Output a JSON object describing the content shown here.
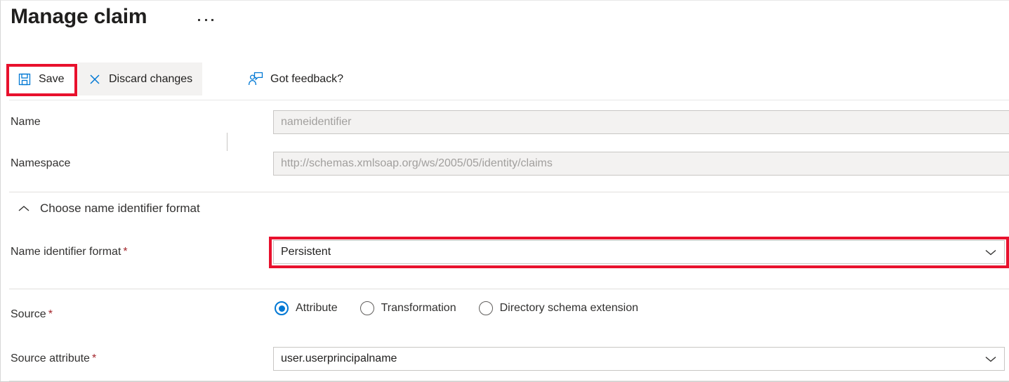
{
  "header": {
    "title": "Manage claim",
    "more_menu": "…"
  },
  "toolbar": {
    "save_label": "Save",
    "save_icon": "save-floppy-icon",
    "discard_label": "Discard changes",
    "discard_icon": "close-x-icon",
    "feedback_label": "Got feedback?",
    "feedback_icon": "person-feedback-icon"
  },
  "form": {
    "name": {
      "label": "Name",
      "value": "nameidentifier",
      "disabled": true
    },
    "namespace": {
      "label": "Namespace",
      "value": "http://schemas.xmlsoap.org/ws/2005/05/identity/claims",
      "disabled": true
    },
    "section": {
      "title": "Choose name identifier format",
      "expanded": true,
      "caret_icon": "chevron-up-icon"
    },
    "name_identifier_format": {
      "label": "Name identifier format",
      "required_marker": "*",
      "value": "Persistent",
      "chevron_icon": "chevron-down-icon",
      "highlighted": true
    },
    "source": {
      "label": "Source",
      "required_marker": "*",
      "options": [
        {
          "label": "Attribute",
          "selected": true
        },
        {
          "label": "Transformation",
          "selected": false
        },
        {
          "label": "Directory schema extension",
          "selected": false
        }
      ]
    },
    "source_attribute": {
      "label": "Source attribute",
      "required_marker": "*",
      "value": "user.userprincipalname",
      "chevron_icon": "chevron-down-icon"
    }
  },
  "colors": {
    "accent": "#0078d4",
    "highlight_box": "#e8112d",
    "required": "#a4262c",
    "disabled_bg": "#f3f2f1"
  }
}
